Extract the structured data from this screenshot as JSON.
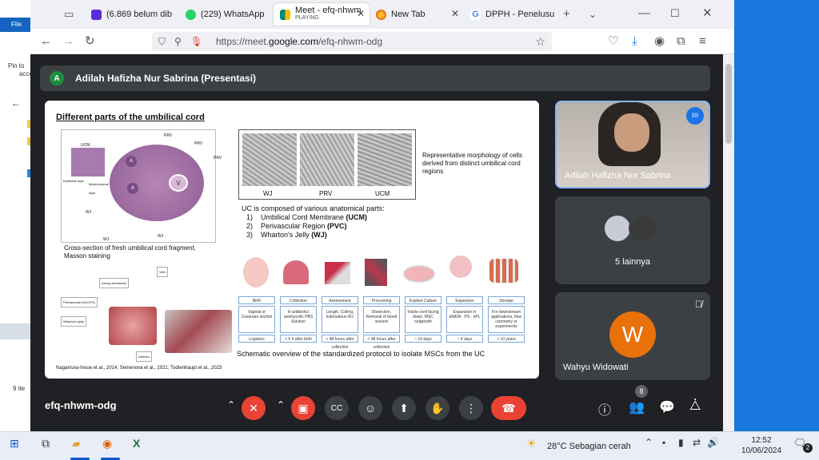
{
  "explorer": {
    "file_label": "File",
    "pin_label": "Pin to",
    "pin_label2": "acce",
    "items_label": "9 ite"
  },
  "tabs": [
    {
      "title": "(6.869 belum dib",
      "icon": "mail-icon",
      "color": "#5b2bd8"
    },
    {
      "title": "(229) WhatsApp",
      "icon": "whatsapp-icon",
      "color": "#25d366"
    },
    {
      "title": "Meet - efq-nhwm",
      "subtitle": "PLAYING",
      "icon": "meet-icon",
      "color": "#00897b"
    },
    {
      "title": "New Tab",
      "icon": "firefox-icon",
      "color": "#e66000"
    },
    {
      "title": "DPPH - Penelusu",
      "icon": "google-icon",
      "color": "#4285f4"
    }
  ],
  "url": {
    "prefix": "https://meet.",
    "domain": "google.com",
    "suffix": "/efq-nhwm-odg"
  },
  "presenter_bar": {
    "initial": "A",
    "text": "Adilah Hafizha Nur Sabrina (Presentasi)"
  },
  "slide": {
    "title": "Different parts of the umbilical cord",
    "micro_labels": {
      "wj": "WJ",
      "prv": "PRV",
      "ucm": "UCM"
    },
    "diagram_labels": {
      "prv": "PRV",
      "ucm": "UCM",
      "wj": "WJ",
      "a": "A",
      "v": "V",
      "epithelial": "Epithelial layer",
      "mesenchymal": "Mesenchymal layer"
    },
    "left_caption": "Cross-section of fresh umbilical cord fragment, Masson staining",
    "right_caption": "Representative morphology of cells derived from distinct umbilical cord regions",
    "uc_intro": "UC is composed of various  anatomical parts:",
    "uc_parts": [
      {
        "num": "1)",
        "name": "Umbilical Cord Membrane ",
        "abbr": "(UCM)"
      },
      {
        "num": "2)",
        "name": "Perivascular Region ",
        "abbr": "(PVC)"
      },
      {
        "num": "3)",
        "name": "Wharton's Jelly ",
        "abbr": "(WJ)"
      }
    ],
    "photo_labels": {
      "lining": "Lining membrane",
      "perivascular": "Perivascular (HUCPV)",
      "wharton": "Wharton's jelly",
      "vein": "Vein",
      "arteries": "Arteries"
    },
    "protocol_steps": [
      {
        "head": "Birth",
        "body": "Vaginal or Cesarean section",
        "foot": "Logistics"
      },
      {
        "head": "Collection",
        "body": "In antibiotic/ antimycotic PBS Solution",
        "foot": "< 6 h after birth"
      },
      {
        "head": "Assessment",
        "body": "Length, Coiling, Edematous WJ",
        "foot": "< 48 hours after collection"
      },
      {
        "head": "Processing",
        "body": "Dissection, Removal of blood vessels",
        "foot": "< 48 hours after collection"
      },
      {
        "head": "Explant Culture",
        "body": "Inside cord facing down, MSC outgrowth",
        "foot": "~ 10 days"
      },
      {
        "head": "Expansion",
        "body": "Expansion in αMEM - PS - hPL",
        "foot": "~ 4 days"
      },
      {
        "head": "Storage",
        "body": "For downstream applications, flow cytometry or experiments",
        "foot": "> 10 years"
      }
    ],
    "protocol_caption": "Schematic overview of the standardized protocol to isolate MSCs from the UC",
    "references": "Nagamura-Inoue et al., 2014; Semenova et al., 2021; Todtenhaupt et al., 2023"
  },
  "participants": [
    {
      "name": "Adilah Hafizha Nur Sabrina"
    },
    {
      "name": "5 lainnya"
    },
    {
      "name": "Wahyu Widowati",
      "initial": "W"
    }
  ],
  "controls": {
    "meeting_code": "efq-nhwm-odg",
    "people_count": "8"
  },
  "taskbar": {
    "weather": "28°C  Sebagian cerah",
    "time": "12:52",
    "date": "10/06/2024",
    "notif_count": "2"
  }
}
